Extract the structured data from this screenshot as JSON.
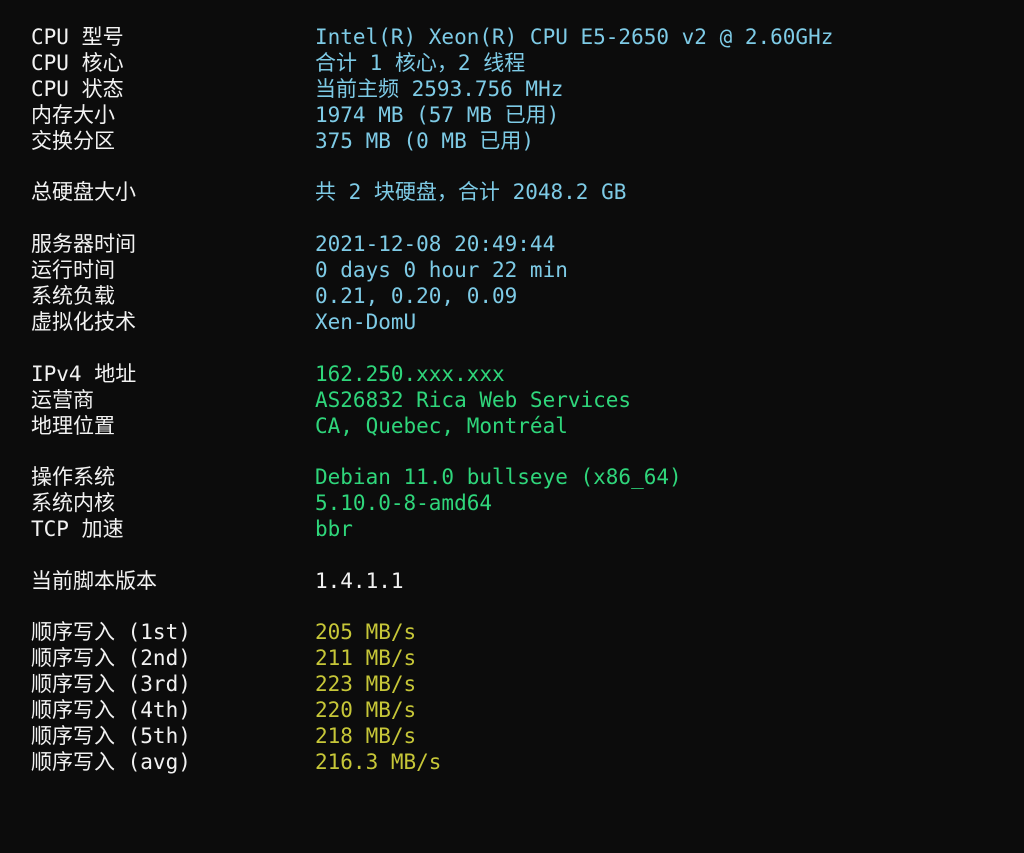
{
  "colors": {
    "background": "#0c0c0c",
    "label": "#f2f2f2",
    "blue": "#7ecbe6",
    "green": "#2fd67b",
    "white": "#f2f2f2",
    "yellow": "#c7c738"
  },
  "system": {
    "cpu_model": {
      "label": "CPU 型号",
      "value": "Intel(R) Xeon(R) CPU E5-2650 v2 @ 2.60GHz"
    },
    "cpu_cores": {
      "label": "CPU 核心",
      "value": "合计 1 核心，2 线程"
    },
    "cpu_status": {
      "label": "CPU 状态",
      "value": "当前主频 2593.756 MHz"
    },
    "memory": {
      "label": "内存大小",
      "value": "1974 MB (57 MB 已用)"
    },
    "swap": {
      "label": "交换分区",
      "value": "375 MB (0 MB 已用)"
    }
  },
  "disk": {
    "total": {
      "label": "总硬盘大小",
      "value": "共 2 块硬盘，合计 2048.2 GB"
    }
  },
  "runtime": {
    "server_time": {
      "label": "服务器时间",
      "value": "2021-12-08 20:49:44"
    },
    "uptime": {
      "label": "运行时间",
      "value": "0 days 0 hour 22 min"
    },
    "load": {
      "label": "系统负载",
      "value": "0.21, 0.20, 0.09"
    },
    "virtualization": {
      "label": "虚拟化技术",
      "value": "Xen-DomU"
    }
  },
  "network": {
    "ipv4": {
      "label": "IPv4 地址",
      "value": "162.250.xxx.xxx"
    },
    "isp": {
      "label": "运营商",
      "value": "AS26832 Rica Web Services"
    },
    "location": {
      "label": "地理位置",
      "value": "CA, Quebec, Montréal"
    }
  },
  "os": {
    "distro": {
      "label": "操作系统",
      "value": "Debian 11.0 bullseye (x86_64)"
    },
    "kernel": {
      "label": "系统内核",
      "value": "5.10.0-8-amd64"
    },
    "tcp": {
      "label": "TCP 加速",
      "value": "bbr"
    }
  },
  "script": {
    "version": {
      "label": "当前脚本版本",
      "value": "1.4.1.1"
    }
  },
  "disk_write": [
    {
      "label": "顺序写入 (1st)",
      "value": "205 MB/s"
    },
    {
      "label": "顺序写入 (2nd)",
      "value": "211 MB/s"
    },
    {
      "label": "顺序写入 (3rd)",
      "value": "223 MB/s"
    },
    {
      "label": "顺序写入 (4th)",
      "value": "220 MB/s"
    },
    {
      "label": "顺序写入 (5th)",
      "value": "218 MB/s"
    },
    {
      "label": "顺序写入 (avg)",
      "value": "216.3 MB/s"
    }
  ]
}
